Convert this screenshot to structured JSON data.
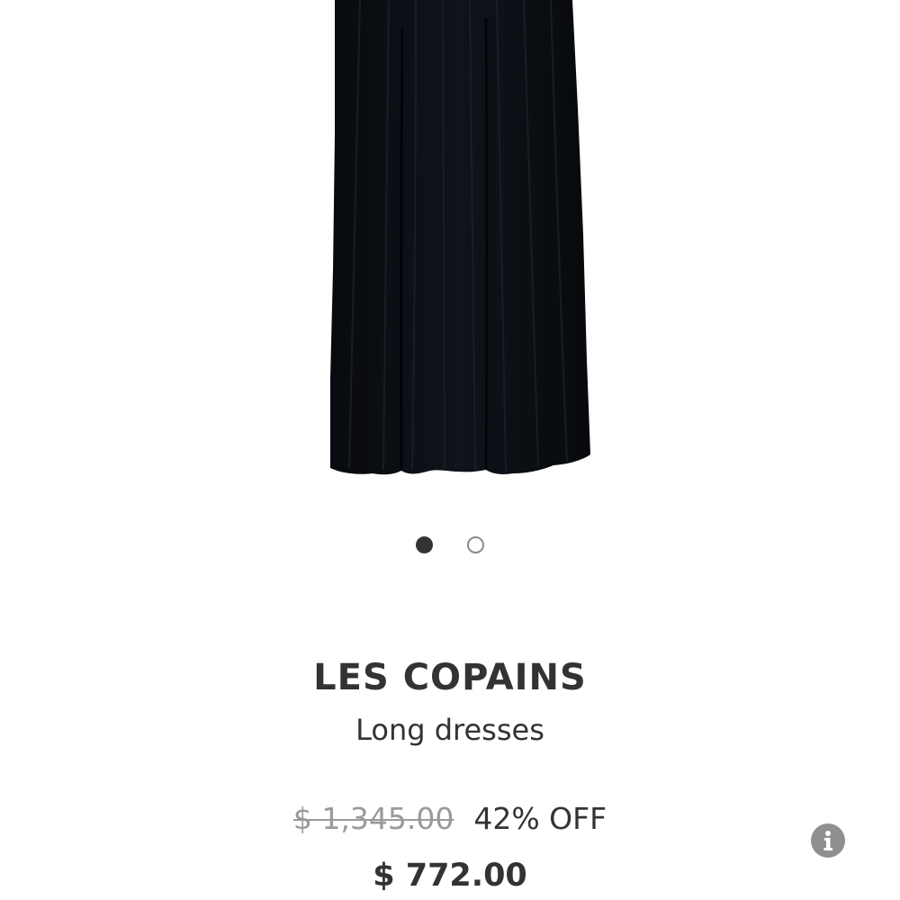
{
  "product_image": {
    "alt": "",
    "icon": "black-long-dress-image"
  },
  "carousel": {
    "total": 2,
    "active_index": 0
  },
  "product": {
    "brand": "LES COPAINS",
    "category": "Long dresses",
    "original_price": "$ 1,345.00",
    "discount": "42% OFF",
    "final_price": "$ 772.00"
  },
  "info_button": {
    "icon": "info-icon"
  },
  "colors": {
    "text": "#333333",
    "muted_price": "#9a9a9a",
    "dress": "#0b0d12",
    "info_icon_bg": "#8f8f8f"
  }
}
